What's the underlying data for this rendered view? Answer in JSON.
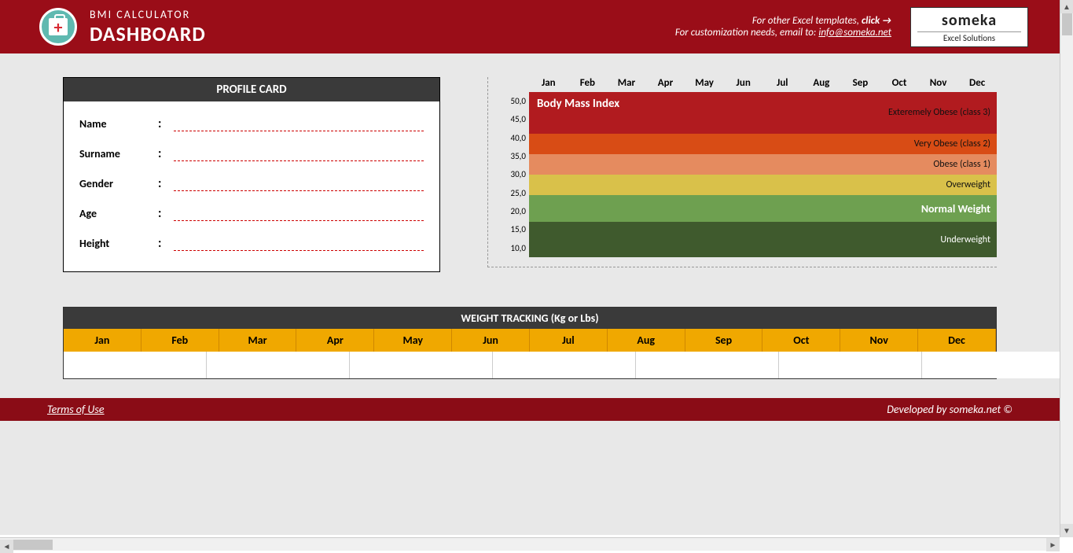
{
  "header": {
    "subtitle": "BMI CALCULATOR",
    "title": "DASHBOARD",
    "templates_text": "For other Excel templates,",
    "click_label": "click",
    "arrow": "→",
    "customization_text": "For customization needs, email to:",
    "email": "info@someka.net",
    "brand_name": "someka",
    "brand_tag": "Excel Solutions"
  },
  "profile": {
    "title": "PROFILE CARD",
    "fields": [
      {
        "label": "Name"
      },
      {
        "label": "Surname"
      },
      {
        "label": "Gender"
      },
      {
        "label": "Age"
      },
      {
        "label": "Height"
      }
    ]
  },
  "months": [
    "Jan",
    "Feb",
    "Mar",
    "Apr",
    "May",
    "Jun",
    "Jul",
    "Aug",
    "Sep",
    "Oct",
    "Nov",
    "Dec"
  ],
  "chart_data": {
    "type": "area",
    "title": "Body Mass Index",
    "xlabel": "",
    "ylabel": "",
    "ylim": [
      10,
      50
    ],
    "y_ticks": [
      "50,0",
      "45,0",
      "40,0",
      "35,0",
      "30,0",
      "25,0",
      "20,0",
      "15,0",
      "10,0"
    ],
    "categories": [
      "Jan",
      "Feb",
      "Mar",
      "Apr",
      "May",
      "Jun",
      "Jul",
      "Aug",
      "Sep",
      "Oct",
      "Nov",
      "Dec"
    ],
    "bands": [
      {
        "name": "Exteremely Obese (class 3)",
        "from": 40,
        "to": 50,
        "color": "#b11b1f"
      },
      {
        "name": "Very Obese (class 2)",
        "from": 35,
        "to": 40,
        "color": "#d84c15"
      },
      {
        "name": "Obese (class 1)",
        "from": 30,
        "to": 35,
        "color": "#e58b5f"
      },
      {
        "name": "Overweight",
        "from": 25,
        "to": 30,
        "color": "#d9c14a"
      },
      {
        "name": "Normal Weight",
        "from": 18.5,
        "to": 25,
        "color": "#6ea050",
        "highlight": true
      },
      {
        "name": "Underweight",
        "from": 10,
        "to": 18.5,
        "color": "#3f5a2d",
        "text_color": "#fff"
      }
    ]
  },
  "tracking": {
    "title": "WEIGHT TRACKING (Kg or Lbs)"
  },
  "footer": {
    "terms": "Terms of Use",
    "credit": "Developed by someka.net ©"
  }
}
